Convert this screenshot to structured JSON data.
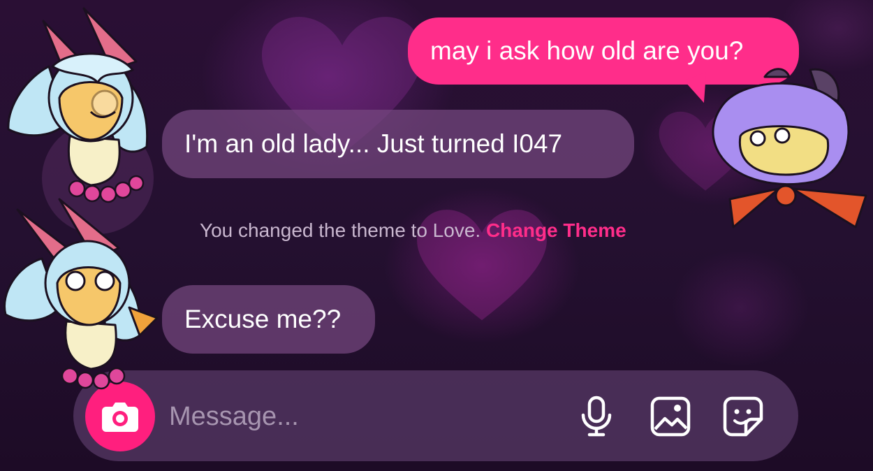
{
  "chat": {
    "messages": [
      {
        "sender": "me",
        "text": "may i ask how old are you?"
      },
      {
        "sender": "them",
        "text": "I'm an old lady... Just turned I047"
      },
      {
        "sender": "them",
        "text": "Excuse me??"
      }
    ],
    "system_notice": {
      "text": "You changed the theme to Love.",
      "action_label": "Change Theme"
    }
  },
  "composer": {
    "placeholder": "Message...",
    "value": "",
    "icons": [
      "camera-icon",
      "microphone-icon",
      "gallery-icon",
      "sticker-icon"
    ]
  },
  "theme": {
    "name": "Love",
    "accent": "#ff2d8a",
    "incoming_bubble": "#76487f",
    "background": "#240f30"
  }
}
